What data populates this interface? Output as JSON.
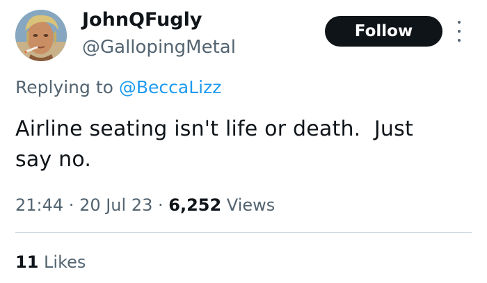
{
  "author": {
    "display_name": "JohnQFugly",
    "handle": "@GallopingMetal",
    "avatar_icon": "user-avatar-photo"
  },
  "follow_button": {
    "label": "Follow"
  },
  "more_menu": {
    "icon": "more-vertical-icon"
  },
  "reply": {
    "prefix": "Replying to ",
    "mention": "@BeccaLizz"
  },
  "tweet": {
    "text": "Airline seating isn't life or death.  Just\nsay no."
  },
  "meta": {
    "time": "21:44",
    "separator_1": " · ",
    "date": "20 Jul 23",
    "separator_2": " · ",
    "views_count": "6,252",
    "views_label": " Views"
  },
  "engagement": {
    "likes_count": "11",
    "likes_label": " Likes"
  },
  "colors": {
    "text_primary": "#0f1419",
    "text_secondary": "#536471",
    "link": "#1d9bf0",
    "button_bg": "#0f1419",
    "divider": "#cfd9de"
  }
}
